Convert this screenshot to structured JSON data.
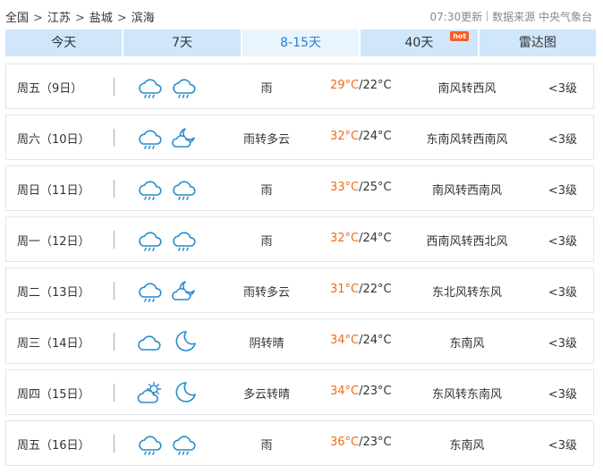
{
  "breadcrumb": {
    "items": [
      "全国",
      "江苏",
      "盐城",
      "滨海"
    ],
    "separator": ">"
  },
  "meta": {
    "update": "07:30更新",
    "source_label": "数据来源",
    "source_name": "中央气象台"
  },
  "tabs": [
    {
      "label": "今天",
      "active": false
    },
    {
      "label": "7天",
      "active": false
    },
    {
      "label": "8-15天",
      "active": true
    },
    {
      "label": "40天",
      "active": false,
      "badge": "hot"
    },
    {
      "label": "雷达图",
      "active": false
    }
  ],
  "colors": {
    "tab_bg": "#cfe6fb",
    "tab_active_bg": "#eaf4fd",
    "tab_active_text": "#2a7fd4",
    "high_temp": "#f06a18",
    "hot_badge": "#ff5a1f",
    "icon_stroke": "#2a8ccc"
  },
  "forecast": [
    {
      "day": "周五（9日）",
      "icon_day": "rain-cloud-icon",
      "icon_night": "rain-cloud-icon",
      "weather": "雨",
      "high": "29°C",
      "low": "/22°C",
      "wind": "南风转西风",
      "level": "<3级"
    },
    {
      "day": "周六（10日）",
      "icon_day": "rain-cloud-icon",
      "icon_night": "partly-cloudy-night-icon",
      "weather": "雨转多云",
      "high": "32°C",
      "low": "/24°C",
      "wind": "东南风转西南风",
      "level": "<3级"
    },
    {
      "day": "周日（11日）",
      "icon_day": "rain-cloud-icon",
      "icon_night": "rain-cloud-icon",
      "weather": "雨",
      "high": "33°C",
      "low": "/25°C",
      "wind": "南风转西南风",
      "level": "<3级"
    },
    {
      "day": "周一（12日）",
      "icon_day": "rain-cloud-icon",
      "icon_night": "rain-cloud-icon",
      "weather": "雨",
      "high": "32°C",
      "low": "/24°C",
      "wind": "西南风转西北风",
      "level": "<3级"
    },
    {
      "day": "周二（13日）",
      "icon_day": "rain-cloud-icon",
      "icon_night": "partly-cloudy-night-icon",
      "weather": "雨转多云",
      "high": "31°C",
      "low": "/22°C",
      "wind": "东北风转东风",
      "level": "<3级"
    },
    {
      "day": "周三（14日）",
      "icon_day": "cloud-icon",
      "icon_night": "moon-icon",
      "weather": "阴转晴",
      "high": "34°C",
      "low": "/24°C",
      "wind": "东南风",
      "level": "<3级"
    },
    {
      "day": "周四（15日）",
      "icon_day": "sun-cloud-icon",
      "icon_night": "moon-icon",
      "weather": "多云转晴",
      "high": "34°C",
      "low": "/23°C",
      "wind": "东风转东南风",
      "level": "<3级"
    },
    {
      "day": "周五（16日）",
      "icon_day": "rain-cloud-icon",
      "icon_night": "rain-cloud-icon",
      "weather": "雨",
      "high": "36°C",
      "low": "/23°C",
      "wind": "东南风",
      "level": "<3级"
    }
  ]
}
